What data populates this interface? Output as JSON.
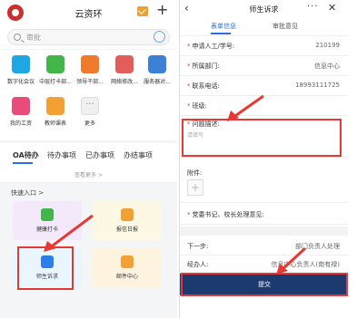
{
  "left": {
    "app_title": "云资环",
    "search_placeholder": "审批",
    "apps": [
      {
        "label": "数字化会议",
        "icon": "meeting-icon",
        "color": "#1ea7e4"
      },
      {
        "label": "中层打卡部...",
        "icon": "checkin-icon",
        "color": "#43b649"
      },
      {
        "label": "领导干部...",
        "icon": "leader-icon",
        "color": "#f07a2b"
      },
      {
        "label": "网络修改...",
        "icon": "network-icon",
        "color": "#e35d5d"
      },
      {
        "label": "服务器对...",
        "icon": "server-icon",
        "color": "#3b82d6"
      },
      {
        "label": "我的工资",
        "icon": "salary-icon",
        "color": "#e94c7a"
      },
      {
        "label": "教师课表",
        "icon": "timetable-icon",
        "color": "#f2a034"
      },
      {
        "label": "更多",
        "icon": "more-icon",
        "color": "#f0f0f0"
      }
    ],
    "tabs": [
      "OA待办",
      "待办事项",
      "已办事项",
      "办结事项"
    ],
    "view_more": "查看更多 >",
    "quick_entry": "快速入口 >",
    "tiles": [
      {
        "label": "健康打卡",
        "icon": "health-checkin-icon",
        "bg": "#f4e9fb",
        "icolor": "#43b649"
      },
      {
        "label": "报信日报",
        "icon": "daily-report-icon",
        "bg": "#fdf8e4",
        "icolor": "#f2a034"
      },
      {
        "label": "师生诉求",
        "icon": "appeal-icon",
        "bg": "#eaf6fd",
        "icolor": "#2b7de9"
      },
      {
        "label": "邮件中心",
        "icon": "mail-center-icon",
        "bg": "#fdf3de",
        "icolor": "#f2a034"
      }
    ]
  },
  "right": {
    "title": "师生诉求",
    "tabs": [
      "表单信息",
      "审批意见"
    ],
    "fields": [
      {
        "label": "申请人工/学号:",
        "value": "210199",
        "required": true
      },
      {
        "label": "所属部门:",
        "value": "信息中心",
        "required": true
      },
      {
        "label": "联系电话:",
        "value": "18993111725",
        "required": true
      },
      {
        "label": "班级:",
        "value": "",
        "required": true
      }
    ],
    "description_label": "问题描述:",
    "description_placeholder": "请填写",
    "attachment_label": "附件:",
    "opinion_label": "党委书记、校长处理意见:",
    "next_step_label": "下一步:",
    "next_step_value": "部门负责人处理",
    "handler_label": "经办人:",
    "handler_value": "信息中心负责人(南有禄)",
    "submit_label": "提交"
  },
  "colors": {
    "accent": "#2b6ee6",
    "highlight": "#e53935",
    "submit_bg": "#1c3a6e"
  }
}
